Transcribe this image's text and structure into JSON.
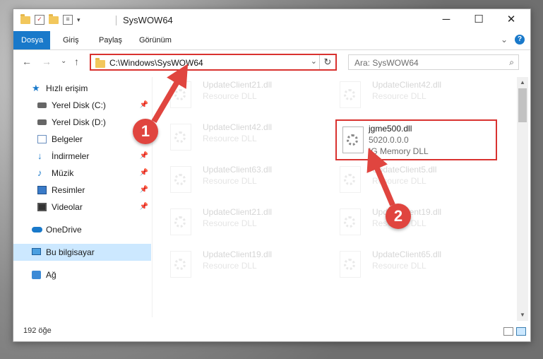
{
  "window": {
    "title": "SysWOW64",
    "controls": {
      "minimize": "─",
      "maximize": "☐",
      "close": "✕"
    }
  },
  "ribbon": {
    "tabs": [
      {
        "label": "Dosya",
        "active": true
      },
      {
        "label": "Giriş"
      },
      {
        "label": "Paylaş"
      },
      {
        "label": "Görünüm"
      }
    ],
    "expand_glyph": "⌄",
    "help_glyph": "?"
  },
  "address": {
    "path": "C:\\Windows\\SysWOW64",
    "refresh_glyph": "↻",
    "dropdown_glyph": "⌄"
  },
  "search": {
    "placeholder": "Ara: SysWOW64",
    "icon": "search-icon"
  },
  "nav_buttons": {
    "back": "←",
    "forward": "→",
    "recent": "⌄",
    "up": "↑"
  },
  "sidebar": {
    "items": [
      {
        "label": "Hızlı erişim",
        "icon": "star-icon"
      },
      {
        "label": "Yerel Disk (C:)",
        "icon": "disk-icon",
        "pinned": true
      },
      {
        "label": "Yerel Disk (D:)",
        "icon": "disk-icon"
      },
      {
        "label": "Belgeler",
        "icon": "documents-icon",
        "pinned": true
      },
      {
        "label": "İndirmeler",
        "icon": "downloads-icon",
        "pinned": true
      },
      {
        "label": "Müzik",
        "icon": "music-icon",
        "pinned": true
      },
      {
        "label": "Resimler",
        "icon": "pictures-icon",
        "pinned": true
      },
      {
        "label": "Videolar",
        "icon": "videos-icon",
        "pinned": true
      },
      {
        "label": "OneDrive",
        "icon": "cloud-icon"
      },
      {
        "label": "Bu bilgisayar",
        "icon": "computer-icon",
        "selected": true
      },
      {
        "label": "Ağ",
        "icon": "network-icon"
      }
    ],
    "pin_glyph": "📌"
  },
  "files": [
    {
      "name": "UpdateClient21.dll",
      "line2": "Resource DLL",
      "faded": true
    },
    {
      "name": "UpdateClient42.dll",
      "line2": "Resource DLL",
      "faded": true
    },
    {
      "name": "UpdateClient42.dll",
      "line2": "Resource DLL",
      "faded": true
    },
    {
      "name": "jgme500.dll",
      "line2": "5020.0.0.0",
      "line3": "IG Memory DLL",
      "highlight": true
    },
    {
      "name": "UpdateClient63.dll",
      "line2": "Resource DLL",
      "faded": true
    },
    {
      "name": "UpdateClient5.dll",
      "line2": "Resource DLL",
      "faded": true
    },
    {
      "name": "UpdateClient21.dll",
      "line2": "Resource DLL",
      "faded": true
    },
    {
      "name": "UpdateClient19.dll",
      "line2": "Resource DLL",
      "faded": true
    },
    {
      "name": "UpdateClient19.dll",
      "line2": "Resource DLL",
      "faded": true
    },
    {
      "name": "UpdateClient65.dll",
      "line2": "Resource DLL",
      "faded": true
    }
  ],
  "status": {
    "count": "192 öğe"
  },
  "annotations": {
    "step1": "1",
    "step2": "2",
    "accent": "#e0453f"
  },
  "colors": {
    "accent_blue": "#1979ca",
    "highlight_red": "#d9322f",
    "selected_bg": "#cce8ff"
  }
}
